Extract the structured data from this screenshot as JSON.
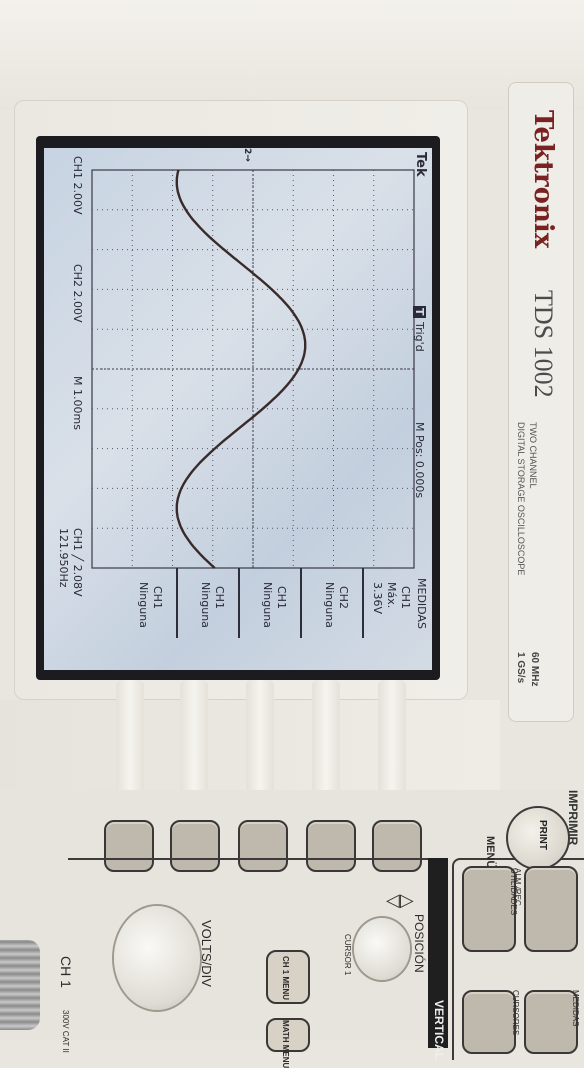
{
  "brand": {
    "name": "Tektronix",
    "model": "TDS 1002",
    "subtitle_line1": "TWO CHANNEL",
    "subtitle_line2": "DIGITAL STORAGE OSCILLOSCOPE",
    "bandwidth": "60 MHz",
    "sample_rate": "1 GS/s"
  },
  "screen": {
    "logo": "Tek",
    "trigger_status": "Trig'd",
    "trigger_marker": "T",
    "time_position": "M Pos: 0.000s",
    "ch1_scale": "CH1  2.00V",
    "ch2_scale": "CH2  2.00V",
    "timebase": "M 1.00ms",
    "trigger_info": "CH1 ╱ 2.08V",
    "frequency": "121.950Hz",
    "ch_marker": "2→"
  },
  "measure_menu": {
    "title": "MEDIDAS",
    "items": [
      {
        "source": "CH1",
        "type": "Máx.",
        "value": "3.36V"
      },
      {
        "source": "CH2",
        "type": "Ninguna",
        "value": ""
      },
      {
        "source": "CH1",
        "type": "Ninguna",
        "value": ""
      },
      {
        "source": "CH1",
        "type": "Ninguna",
        "value": ""
      },
      {
        "source": "CH1",
        "type": "Ninguna",
        "value": ""
      }
    ]
  },
  "controls": {
    "print_section": "IMPRIMIR",
    "print_button": "PRINT",
    "menus_label": "MENÜS",
    "save_recall": "ALM./REC.",
    "utilities": "UTILIDADES",
    "measure": "MEDIDAS",
    "cursors": "CURSORES",
    "vertical": "VERTICAL",
    "position": "POSICIÓN",
    "cursor1": "CURSOR 1",
    "volts_div": "VOLTS/DIV",
    "ch1_menu": "CH 1 MENU",
    "math_menu": "MATH MENU",
    "ch1_label": "CH 1",
    "cat_rating": "300V CAT II"
  },
  "colors": {
    "trace": "#3a2a2a",
    "lcd_bg": "#d2dbe6",
    "text": "#2a2a38"
  },
  "waveform": {
    "type": "sine",
    "frequency_hz": 121.95,
    "peak_v": 3.36
  }
}
